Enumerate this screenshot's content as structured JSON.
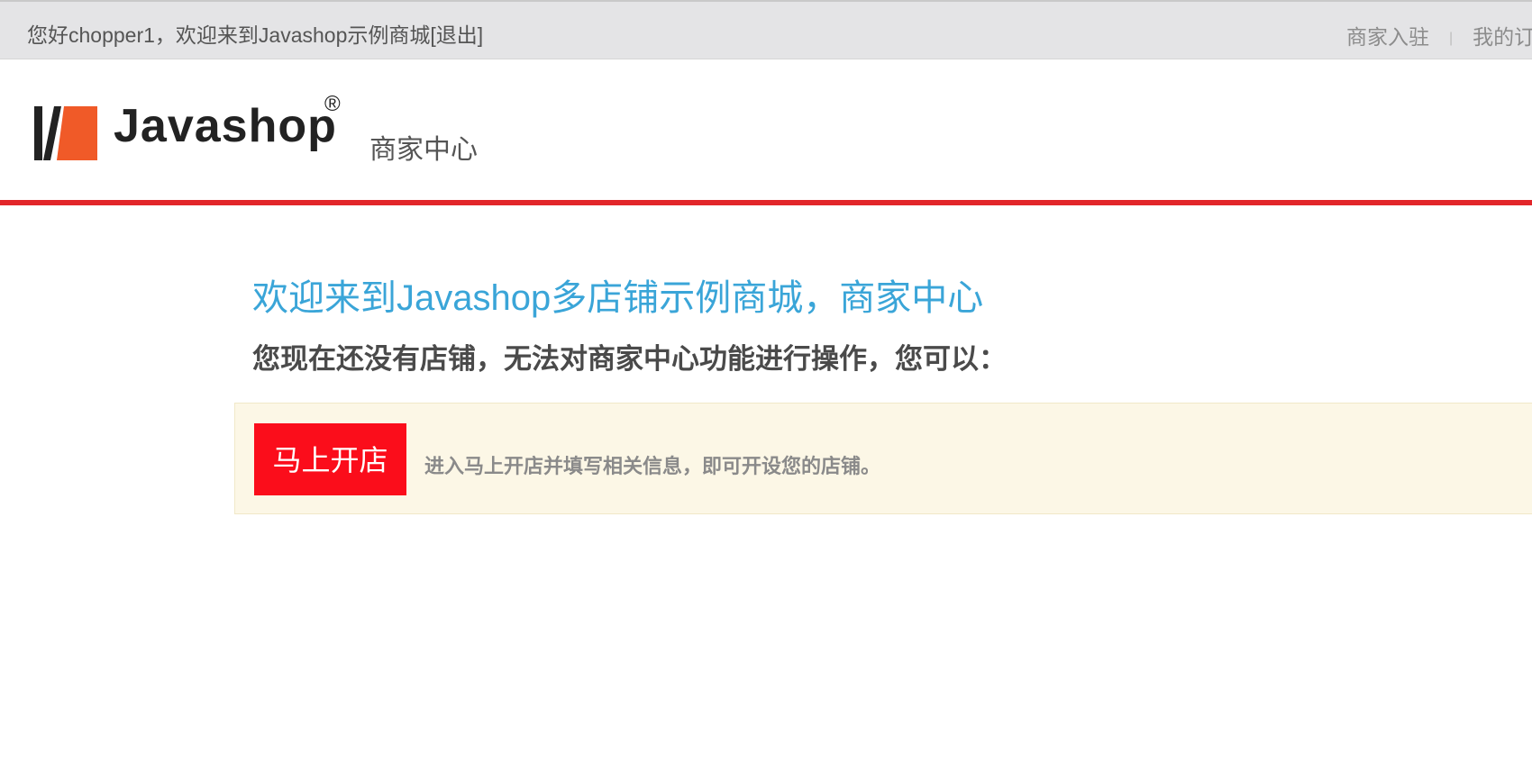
{
  "topbar": {
    "greeting_prefix": "您好chopper1，欢迎来到Javashop示例商城",
    "logout_label": "[退出]",
    "right_links": [
      {
        "label": "商家入驻"
      },
      {
        "label": "我的订"
      }
    ],
    "separator": "|"
  },
  "header": {
    "logo_text": "Javashop",
    "logo_reg": "®",
    "subtitle": "商家中心",
    "accent_color": "#e2262a",
    "logo_orange": "#f05a28"
  },
  "main": {
    "welcome_title": "欢迎来到Javashop多店铺示例商城，商家中心",
    "welcome_sub": "您现在还没有店铺，无法对商家中心功能进行操作，您可以：",
    "open_shop_button": "马上开店",
    "open_shop_desc": "进入马上开店并填写相关信息，即可开设您的店铺。",
    "title_color": "#3aa5d8",
    "button_color": "#fb0d1b"
  }
}
